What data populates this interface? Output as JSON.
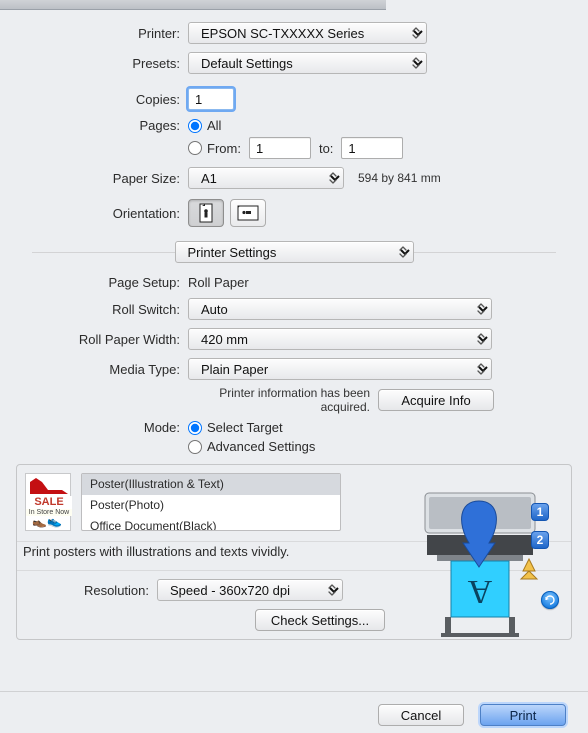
{
  "top": {
    "printer_label": "Printer:",
    "printer_value": "EPSON SC-TXXXXX Series",
    "presets_label": "Presets:",
    "presets_value": "Default Settings",
    "copies_label": "Copies:",
    "copies_value": "1",
    "pages_label": "Pages:",
    "pages_all": "All",
    "pages_from_label": "From:",
    "pages_from_value": "1",
    "pages_to_label": "to:",
    "pages_to_value": "1",
    "paper_size_label": "Paper Size:",
    "paper_size_value": "A1",
    "paper_size_note": "594 by 841 mm",
    "orientation_label": "Orientation:",
    "section_select": "Printer Settings"
  },
  "ps": {
    "page_setup_label": "Page Setup:",
    "page_setup_value": "Roll Paper",
    "roll_switch_label": "Roll Switch:",
    "roll_switch_value": "Auto",
    "roll_width_label": "Roll Paper Width:",
    "roll_width_value": "420 mm",
    "media_type_label": "Media Type:",
    "media_type_value": "Plain Paper",
    "info_acquired": "Printer information has been acquired.",
    "acquire_btn": "Acquire Info",
    "mode_label": "Mode:",
    "mode_select_target": "Select Target",
    "mode_advanced": "Advanced Settings",
    "targets": [
      "Poster(Illustration & Text)",
      "Poster(Photo)",
      "Office Document(Black)"
    ],
    "target_selected_index": 0,
    "hint": "Print posters with illustrations and texts vividly.",
    "resolution_label": "Resolution:",
    "resolution_value": "Speed - 360x720 dpi",
    "check_settings_btn": "Check Settings...",
    "thumb": {
      "sale": "SALE",
      "sale_sub": "In Store Now"
    },
    "badges": {
      "one": "1",
      "two": "2"
    },
    "preview_letter": "A"
  },
  "footer": {
    "cancel": "Cancel",
    "print": "Print"
  }
}
